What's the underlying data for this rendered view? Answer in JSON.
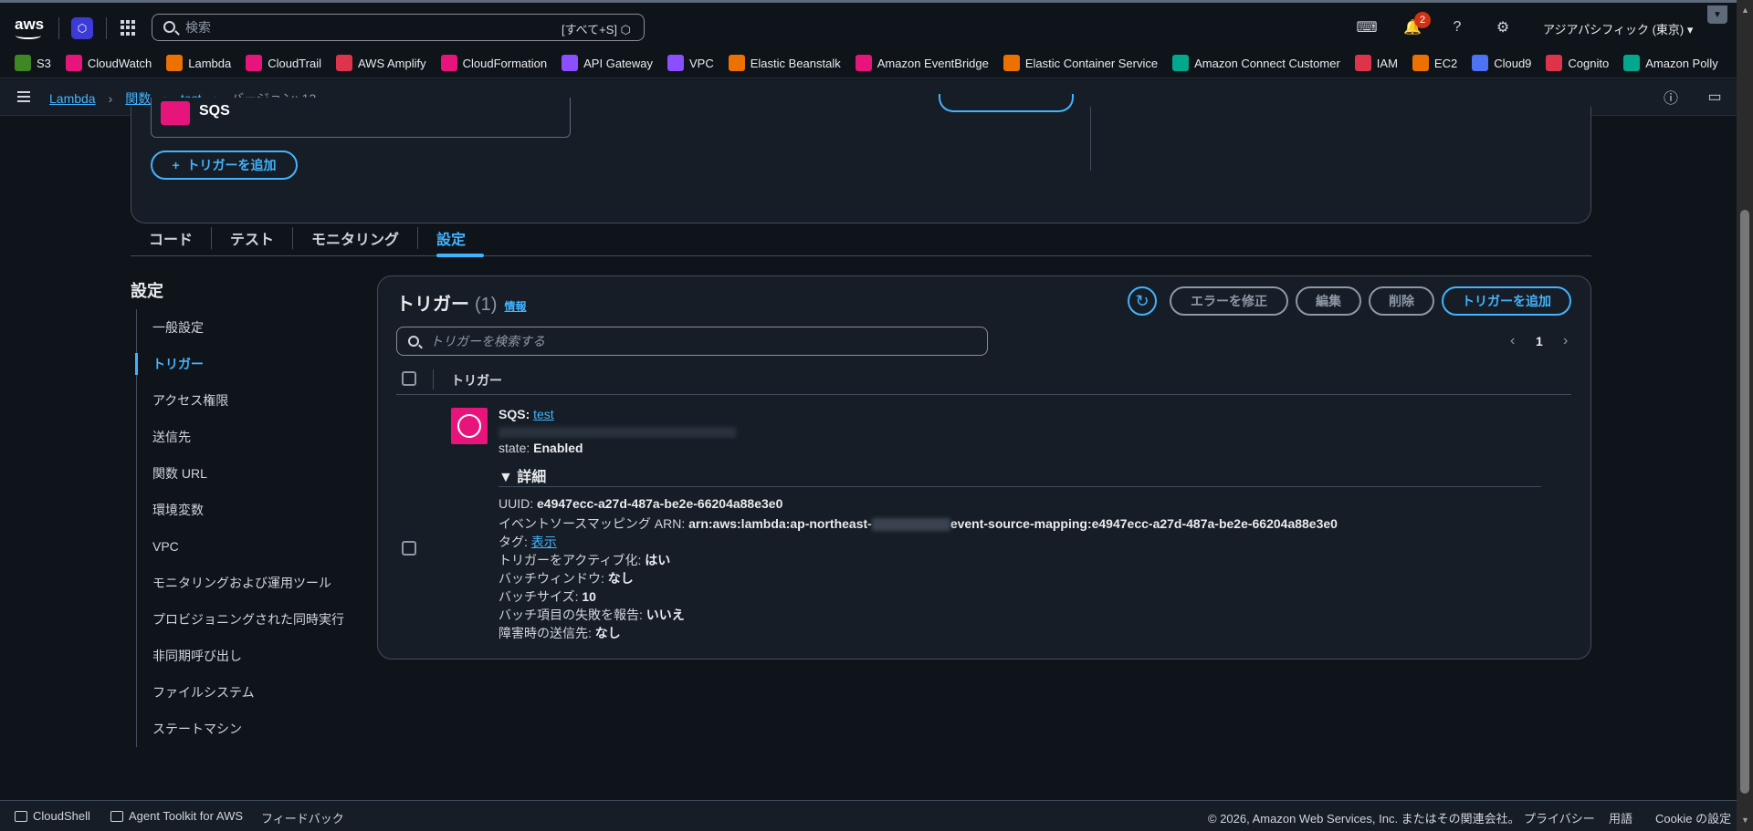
{
  "topnav": {
    "search_placeholder": "検索",
    "search_shortcut": "[すべて+S]",
    "notification_count": "2",
    "region": "アジアパシフィック (東京) ▾",
    "aws_logo_text": "aws"
  },
  "favorites": [
    {
      "label": "S3",
      "color": "#3f8624"
    },
    {
      "label": "CloudWatch",
      "color": "#e7157b"
    },
    {
      "label": "Lambda",
      "color": "#ed7100"
    },
    {
      "label": "CloudTrail",
      "color": "#e7157b"
    },
    {
      "label": "AWS Amplify",
      "color": "#dd344c"
    },
    {
      "label": "CloudFormation",
      "color": "#e7157b"
    },
    {
      "label": "API Gateway",
      "color": "#8c4fff"
    },
    {
      "label": "VPC",
      "color": "#8c4fff"
    },
    {
      "label": "Elastic Beanstalk",
      "color": "#ed7100"
    },
    {
      "label": "Amazon EventBridge",
      "color": "#e7157b"
    },
    {
      "label": "Elastic Container Service",
      "color": "#ed7100"
    },
    {
      "label": "Amazon Connect Customer",
      "color": "#01a88d"
    },
    {
      "label": "IAM",
      "color": "#dd344c"
    },
    {
      "label": "EC2",
      "color": "#ed7100"
    },
    {
      "label": "Cloud9",
      "color": "#4d72f3"
    },
    {
      "label": "Cognito",
      "color": "#dd344c"
    },
    {
      "label": "Amazon Polly",
      "color": "#01a88d"
    }
  ],
  "breadcrumb": {
    "items": [
      "Lambda",
      "関数",
      "test"
    ],
    "current": "バージョン: 13"
  },
  "diagram": {
    "sqs_label": "SQS",
    "add_trigger": "トリガーを追加"
  },
  "tabs": [
    "コード",
    "テスト",
    "モニタリング",
    "設定"
  ],
  "sidebar": {
    "title": "設定",
    "items": [
      "一般設定",
      "トリガー",
      "アクセス権限",
      "送信先",
      "関数 URL",
      "環境変数",
      "VPC",
      "モニタリングおよび運用ツール",
      "プロビジョニングされた同時実行",
      "非同期呼び出し",
      "ファイルシステム",
      "ステートマシン"
    ]
  },
  "triggers": {
    "title": "トリガー",
    "count": "(1)",
    "info": "情報",
    "buttons": {
      "fix_errors": "エラーを修正",
      "edit": "編集",
      "delete": "削除",
      "add": "トリガーを追加"
    },
    "search_placeholder": "トリガーを検索する",
    "page": "1",
    "column_header": "トリガー",
    "row": {
      "source_label": "SQS:",
      "source_name": "test",
      "state_label": "state:",
      "state_value": "Enabled",
      "details_label": "▼ 詳細",
      "uuid_label": "UUID:",
      "uuid_value": "e4947ecc-a27d-487a-be2e-66204a88e3e0",
      "arn_label": "イベントソースマッピング ARN:",
      "arn_prefix": "arn:aws:lambda:ap-northeast-",
      "arn_suffix": "event-source-mapping:e4947ecc-a27d-487a-be2e-66204a88e3e0",
      "tags_label": "タグ:",
      "tags_link": "表示",
      "activate_label": "トリガーをアクティブ化:",
      "activate_value": "はい",
      "batch_window_label": "バッチウィンドウ:",
      "batch_window_value": "なし",
      "batch_size_label": "バッチサイズ:",
      "batch_size_value": "10",
      "report_failures_label": "バッチ項目の失敗を報告:",
      "report_failures_value": "いいえ",
      "on_failure_label": "障害時の送信先:",
      "on_failure_value": "なし"
    }
  },
  "footer": {
    "cloudshell": "CloudShell",
    "agent_toolkit": "Agent Toolkit for AWS",
    "feedback": "フィードバック",
    "copyright": "© 2026, Amazon Web Services, Inc. またはその関連会社。",
    "privacy": "プライバシー",
    "terms": "用語",
    "cookie": "Cookie の設定"
  }
}
